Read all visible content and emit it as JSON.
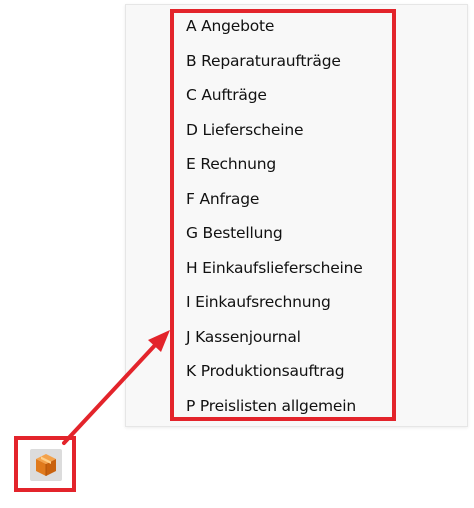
{
  "menu": {
    "items": [
      {
        "label": "A Angebote"
      },
      {
        "label": "B Reparaturaufträge"
      },
      {
        "label": "C Aufträge"
      },
      {
        "label": "D Lieferscheine"
      },
      {
        "label": "E Rechnung"
      },
      {
        "label": "F Anfrage"
      },
      {
        "label": "G Bestellung"
      },
      {
        "label": "H Einkaufslieferscheine"
      },
      {
        "label": "I Einkaufsrechnung"
      },
      {
        "label": "J Kassenjournal"
      },
      {
        "label": "K Produktionsauftrag"
      },
      {
        "label": "P Preislisten allgemein"
      }
    ]
  },
  "annotation": {
    "color": "#e3242b"
  },
  "app_icon": {
    "icon": "package-box-icon",
    "color": "#e8892b"
  }
}
